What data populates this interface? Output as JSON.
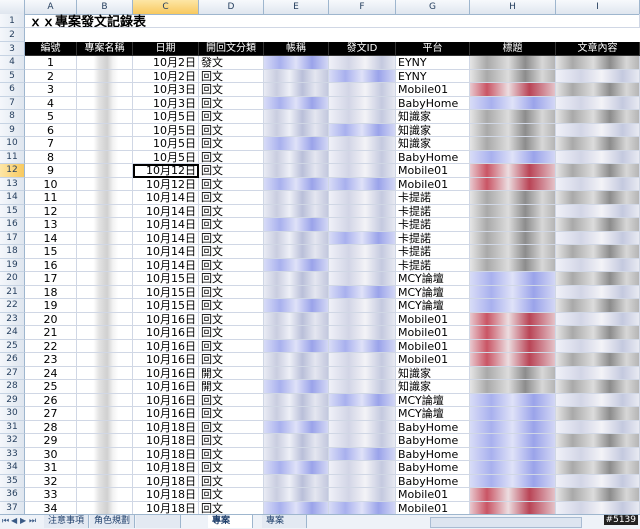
{
  "sheet": {
    "columns": [
      "A",
      "B",
      "C",
      "D",
      "E",
      "F",
      "G",
      "H",
      "I"
    ],
    "selected_column": "C",
    "selected_row": 12,
    "title": "ｘｘ專案發文記錄表",
    "headers": [
      "編號",
      "專案名稱",
      "日期",
      "開回文分類",
      "帳稱",
      "發文ID",
      "平台",
      "標題",
      "文章內容"
    ],
    "rows": [
      {
        "r": 4,
        "no": "1",
        "date": "10月2日",
        "type": "發文",
        "platform": "EYNY",
        "h": "blurGray"
      },
      {
        "r": 5,
        "no": "2",
        "date": "10月2日",
        "type": "回文",
        "platform": "EYNY",
        "h": "blurGray"
      },
      {
        "r": 6,
        "no": "3",
        "date": "10月3日",
        "type": "回文",
        "platform": "Mobile01",
        "h": "blurRed"
      },
      {
        "r": 7,
        "no": "4",
        "date": "10月3日",
        "type": "回文",
        "platform": "BabyHome",
        "h": "blurBlue"
      },
      {
        "r": 8,
        "no": "5",
        "date": "10月5日",
        "type": "回文",
        "platform": "知識家",
        "h": "blurGray"
      },
      {
        "r": 9,
        "no": "6",
        "date": "10月5日",
        "type": "回文",
        "platform": "知識家",
        "h": "blurGray"
      },
      {
        "r": 10,
        "no": "7",
        "date": "10月5日",
        "type": "回文",
        "platform": "知識家",
        "h": "blurGray"
      },
      {
        "r": 11,
        "no": "8",
        "date": "10月5日",
        "type": "回文",
        "platform": "BabyHome",
        "h": "blurBlue"
      },
      {
        "r": 12,
        "no": "9",
        "date": "10月12日",
        "type": "回文",
        "platform": "Mobile01",
        "h": "blurRed"
      },
      {
        "r": 13,
        "no": "10",
        "date": "10月12日",
        "type": "回文",
        "platform": "Mobile01",
        "h": "blurRed"
      },
      {
        "r": 14,
        "no": "11",
        "date": "10月14日",
        "type": "回文",
        "platform": "卡提諾",
        "h": "blurGray"
      },
      {
        "r": 15,
        "no": "12",
        "date": "10月14日",
        "type": "回文",
        "platform": "卡提諾",
        "h": "blurGray"
      },
      {
        "r": 16,
        "no": "13",
        "date": "10月14日",
        "type": "回文",
        "platform": "卡提諾",
        "h": "blurGray"
      },
      {
        "r": 17,
        "no": "14",
        "date": "10月14日",
        "type": "回文",
        "platform": "卡提諾",
        "h": "blurGray"
      },
      {
        "r": 18,
        "no": "15",
        "date": "10月14日",
        "type": "回文",
        "platform": "卡提諾",
        "h": "blurGray"
      },
      {
        "r": 19,
        "no": "16",
        "date": "10月14日",
        "type": "回文",
        "platform": "卡提諾",
        "h": "blurGray"
      },
      {
        "r": 20,
        "no": "17",
        "date": "10月15日",
        "type": "回文",
        "platform": "MCY論壇",
        "h": "blurBlue"
      },
      {
        "r": 21,
        "no": "18",
        "date": "10月15日",
        "type": "回文",
        "platform": "MCY論壇",
        "h": "blurBlue"
      },
      {
        "r": 22,
        "no": "19",
        "date": "10月15日",
        "type": "回文",
        "platform": "MCY論壇",
        "h": "blurBlue"
      },
      {
        "r": 23,
        "no": "20",
        "date": "10月16日",
        "type": "回文",
        "platform": "Mobile01",
        "h": "blurRed"
      },
      {
        "r": 24,
        "no": "21",
        "date": "10月16日",
        "type": "回文",
        "platform": "Mobile01",
        "h": "blurRed"
      },
      {
        "r": 25,
        "no": "22",
        "date": "10月16日",
        "type": "回文",
        "platform": "Mobile01",
        "h": "blurRed"
      },
      {
        "r": 26,
        "no": "23",
        "date": "10月16日",
        "type": "回文",
        "platform": "Mobile01",
        "h": "blurRed"
      },
      {
        "r": 27,
        "no": "24",
        "date": "10月16日",
        "type": "開文",
        "platform": "知識家",
        "h": "blurGray"
      },
      {
        "r": 28,
        "no": "25",
        "date": "10月16日",
        "type": "開文",
        "platform": "知識家",
        "h": "blurGray"
      },
      {
        "r": 29,
        "no": "26",
        "date": "10月16日",
        "type": "回文",
        "platform": "MCY論壇",
        "h": "blurBlue"
      },
      {
        "r": 30,
        "no": "27",
        "date": "10月16日",
        "type": "回文",
        "platform": "MCY論壇",
        "h": "blurBlue"
      },
      {
        "r": 31,
        "no": "28",
        "date": "10月18日",
        "type": "回文",
        "platform": "BabyHome",
        "h": "blurBlue"
      },
      {
        "r": 32,
        "no": "29",
        "date": "10月18日",
        "type": "回文",
        "platform": "BabyHome",
        "h": "blurBlue"
      },
      {
        "r": 33,
        "no": "30",
        "date": "10月18日",
        "type": "回文",
        "platform": "BabyHome",
        "h": "blurBlue"
      },
      {
        "r": 34,
        "no": "31",
        "date": "10月18日",
        "type": "回文",
        "platform": "BabyHome",
        "h": "blurBlue"
      },
      {
        "r": 35,
        "no": "32",
        "date": "10月18日",
        "type": "回文",
        "platform": "BabyHome",
        "h": "blurBlue"
      },
      {
        "r": 36,
        "no": "33",
        "date": "10月18日",
        "type": "回文",
        "platform": "Mobile01",
        "h": "blurRed"
      },
      {
        "r": 37,
        "no": "34",
        "date": "10月18日",
        "type": "回文",
        "platform": "Mobile01",
        "h": "blurRed"
      }
    ]
  },
  "tabs": [
    {
      "label": "注意事項",
      "active": false
    },
    {
      "label": "角色規劃",
      "active": false
    },
    {
      "label": "",
      "active": false
    },
    {
      "label": "專案",
      "active": true
    },
    {
      "label": "專案",
      "active": false
    }
  ],
  "watermark": "#5139"
}
